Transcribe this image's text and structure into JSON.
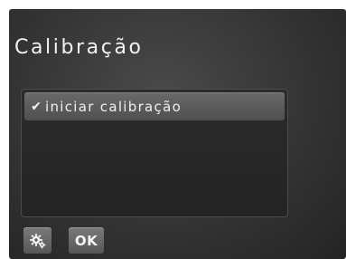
{
  "header": {
    "title": "Calibração"
  },
  "menu": {
    "items": [
      {
        "label": "iniciar calibração",
        "checked": true,
        "icon": "checkmark-icon"
      }
    ]
  },
  "footer": {
    "settings_icon": "gears-icon",
    "ok_label": "OK"
  },
  "colors": {
    "background": "#343434",
    "selected_item": "#5e5e5e",
    "text": "#f0f0f0"
  }
}
